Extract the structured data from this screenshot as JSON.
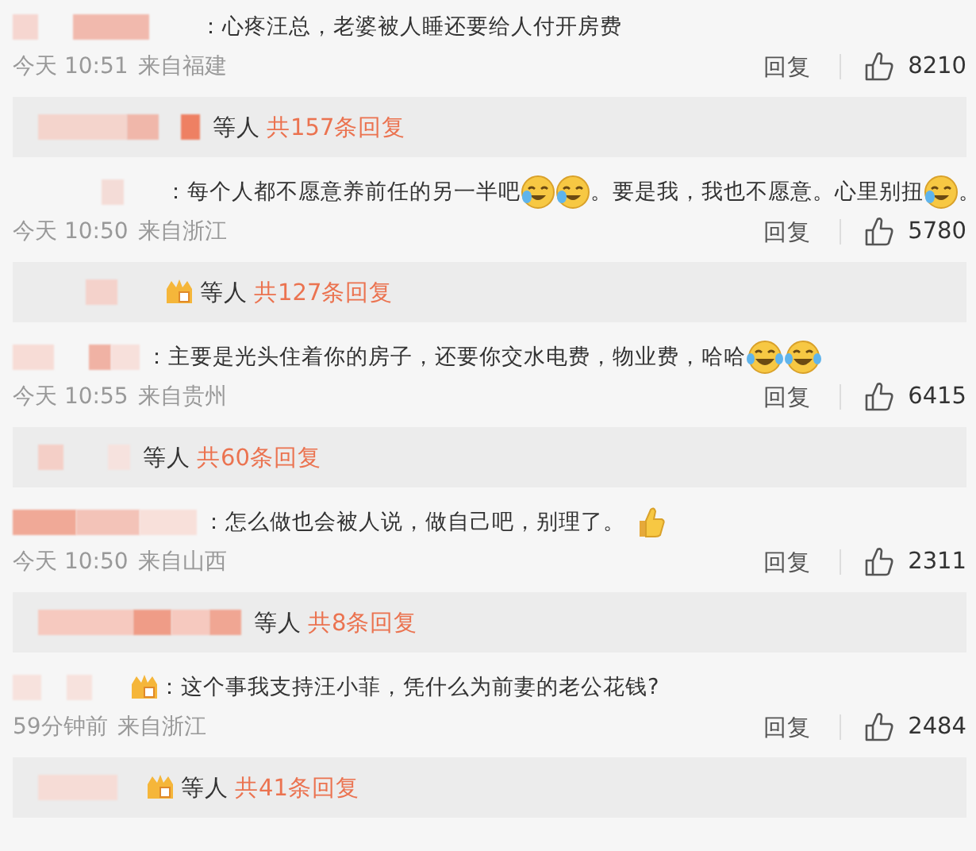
{
  "comments": [
    {
      "segments": [
        {
          "kind": "text",
          "text": "：心疼汪总，老婆被人睡还要给人付开房费"
        }
      ],
      "badge": false,
      "time": "今天 10:51",
      "location": "来自福建",
      "reply_label": "回复",
      "likes": "8210",
      "summary": {
        "badge": false,
        "others": "等人",
        "count": "共157条回复"
      }
    },
    {
      "segments": [
        {
          "kind": "text",
          "text": "：每个人都不愿意养前任的另一半吧"
        },
        {
          "kind": "laugh_cry"
        },
        {
          "kind": "laugh_cry"
        },
        {
          "kind": "text",
          "text": "。要是我，我也不愿意。心里别扭"
        },
        {
          "kind": "laugh_cry"
        },
        {
          "kind": "text",
          "text": "。"
        }
      ],
      "badge": false,
      "time": "今天 10:50",
      "location": "来自浙江",
      "reply_label": "回复",
      "likes": "5780",
      "summary": {
        "badge": true,
        "others": "等人",
        "count": "共127条回复"
      }
    },
    {
      "segments": [
        {
          "kind": "text",
          "text": "：主要是光头住着你的房子，还要你交水电费，物业费，哈哈"
        },
        {
          "kind": "tears_joy"
        },
        {
          "kind": "tears_joy"
        }
      ],
      "badge": false,
      "time": "今天 10:55",
      "location": "来自贵州",
      "reply_label": "回复",
      "likes": "6415",
      "summary": {
        "badge": false,
        "others": "等人",
        "count": "共60条回复"
      }
    },
    {
      "segments": [
        {
          "kind": "text",
          "text": "：怎么做也会被人说，做自己吧，别理了。"
        },
        {
          "kind": "thumbs_up"
        }
      ],
      "badge": false,
      "time": "今天 10:50",
      "location": "来自山西",
      "reply_label": "回复",
      "likes": "2311",
      "summary": {
        "badge": false,
        "others": "等人",
        "count": "共8条回复"
      }
    },
    {
      "segments": [
        {
          "kind": "text",
          "text": "：这个事我支持汪小菲，凭什么为前妻的老公花钱?"
        }
      ],
      "badge": true,
      "time": "59分钟前",
      "location": "来自浙江",
      "reply_label": "回复",
      "likes": "2484",
      "summary": {
        "badge": true,
        "others": "等人",
        "count": "共41条回复"
      }
    }
  ]
}
